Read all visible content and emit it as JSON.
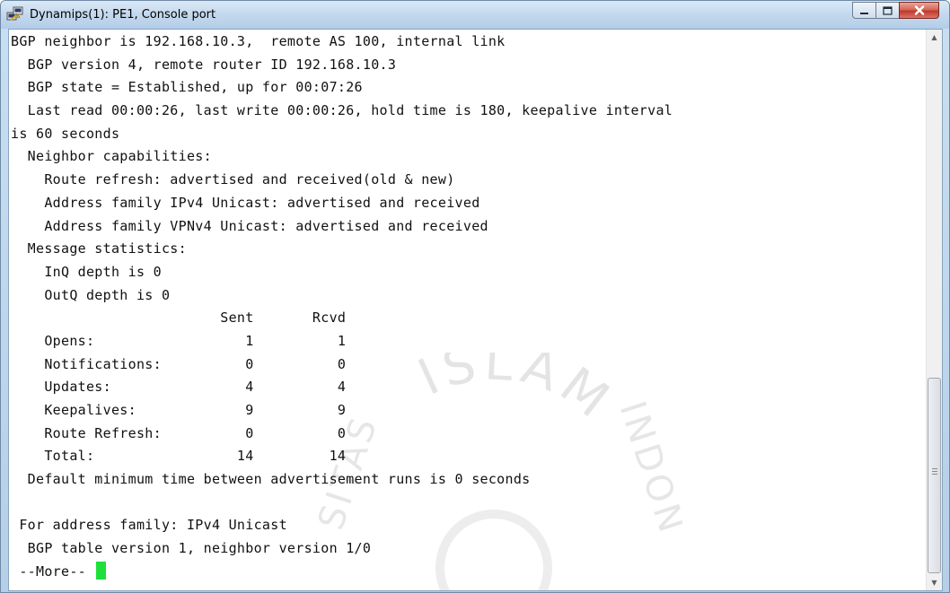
{
  "window": {
    "title": "Dynamips(1): PE1, Console port",
    "icon": "putty-terminal-icon"
  },
  "controls": {
    "minimize": "minimize-icon",
    "maximize": "maximize-icon",
    "close": "close-icon"
  },
  "console": {
    "lines": [
      "BGP neighbor is 192.168.10.3,  remote AS 100, internal link",
      "  BGP version 4, remote router ID 192.168.10.3",
      "  BGP state = Established, up for 00:07:26",
      "  Last read 00:00:26, last write 00:00:26, hold time is 180, keepalive interval",
      "is 60 seconds",
      "  Neighbor capabilities:",
      "    Route refresh: advertised and received(old & new)",
      "    Address family IPv4 Unicast: advertised and received",
      "    Address family VPNv4 Unicast: advertised and received",
      "  Message statistics:",
      "    InQ depth is 0",
      "    OutQ depth is 0",
      "                         Sent       Rcvd",
      "    Opens:                  1          1",
      "    Notifications:          0          0",
      "    Updates:                4          4",
      "    Keepalives:             9          9",
      "    Route Refresh:          0          0",
      "    Total:                 14         14",
      "  Default minimum time between advertisement runs is 0 seconds",
      "",
      " For address family: IPv4 Unicast",
      "  BGP table version 1, neighbor version 1/0"
    ],
    "prompt": " --More-- ",
    "cursor_color": "#1fe03a"
  },
  "watermark": {
    "text_top": "ISLAM",
    "text_left": "SITAS",
    "text_right": "INDON"
  }
}
